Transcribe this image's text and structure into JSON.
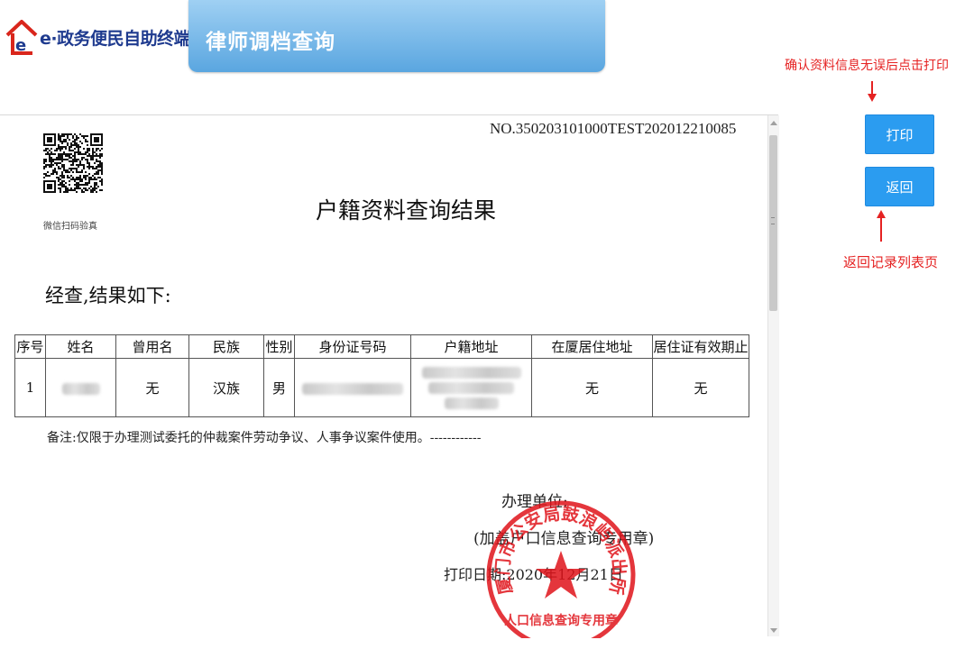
{
  "header": {
    "logo_text": "e·政务便民自助终端",
    "page_title": "律师调档查询"
  },
  "document": {
    "doc_no": "NO.350203101000TEST202012210085",
    "qr_caption": "微信扫码验真",
    "title": "户籍资料查询结果",
    "intro": "经查,结果如下:",
    "table": {
      "headers": [
        "序号",
        "姓名",
        "曾用名",
        "民族",
        "性别",
        "身份证号码",
        "户籍地址",
        "在厦居住地址",
        "居住证有效期止"
      ],
      "rows": [
        {
          "index": "1",
          "name": "",
          "former_name": "无",
          "ethnicity": "汉族",
          "gender": "男",
          "id_number": "",
          "address": "",
          "xiamen_address": "无",
          "permit_expiry": "无"
        }
      ]
    },
    "remark": "备注:仅限于办理测试委托的仲裁案件劳动争议、人事争议案件使用。------------",
    "dept_label": "办理单位:",
    "seal_note": "(加盖户口信息查询专用章)",
    "print_date": "打印日期:2020年12月21日",
    "seal": {
      "outer_text": "厦门市公安局鼓浪屿派出所",
      "inner_text": "人口信息查询专用章",
      "color": "#e0141b"
    }
  },
  "sidebar": {
    "hint_print": "确认资料信息无误后点击打印",
    "print_button": "打印",
    "back_button": "返回",
    "hint_back": "返回记录列表页",
    "accent_color": "#2b9cf0",
    "hint_color": "#e52222"
  }
}
